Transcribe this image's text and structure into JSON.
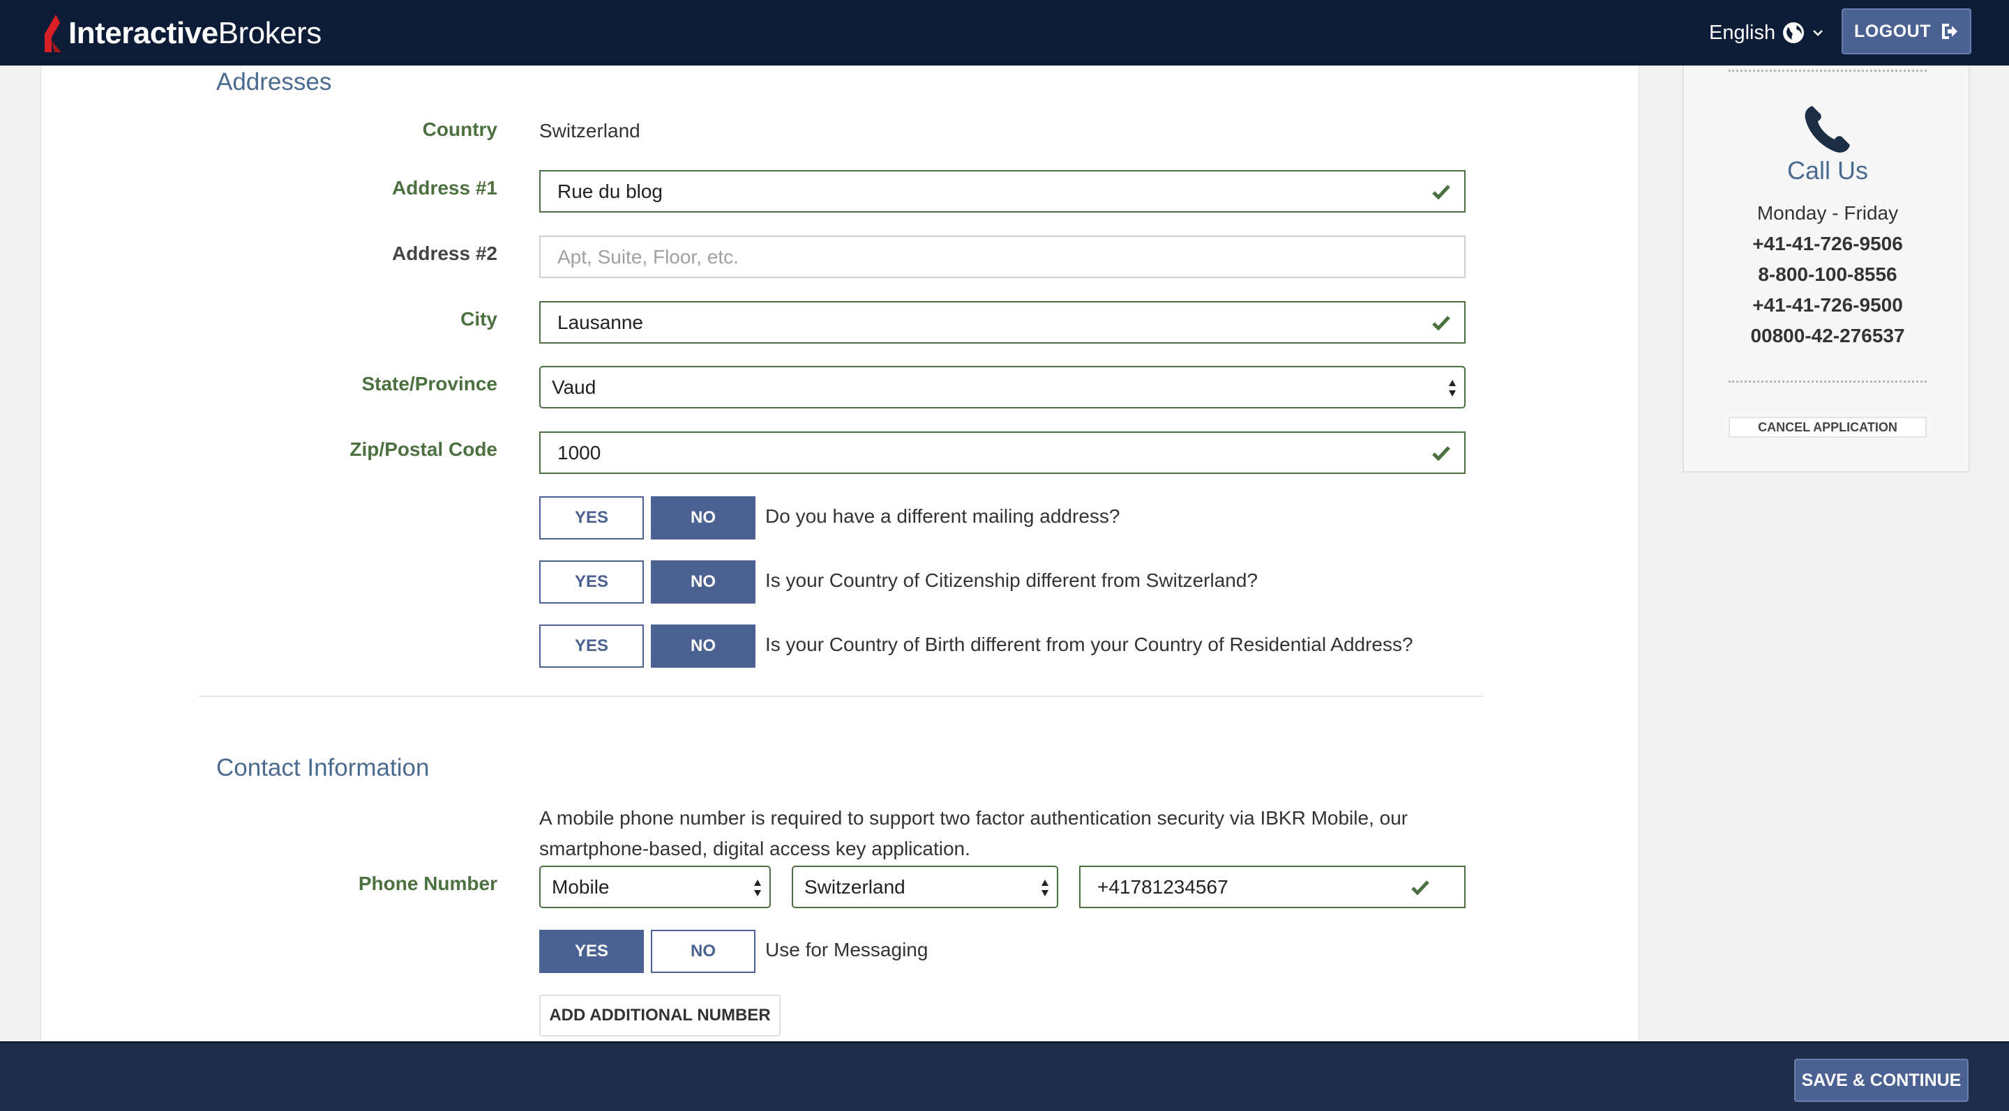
{
  "header": {
    "brand_bold": "Interactive",
    "brand_light": "Brokers",
    "language": "English",
    "logout_label": "LOGOUT"
  },
  "addresses": {
    "title": "Addresses",
    "country_label": "Country",
    "country_value": "Switzerland",
    "address1_label": "Address #1",
    "address1_value": "Rue du blog",
    "address2_label": "Address #2",
    "address2_placeholder": "Apt, Suite, Floor, etc.",
    "city_label": "City",
    "city_value": "Lausanne",
    "state_label": "State/Province",
    "state_value": "Vaud",
    "zip_label": "Zip/Postal Code",
    "zip_value": "1000",
    "questions": [
      {
        "yes": "YES",
        "no": "NO",
        "selected": "NO",
        "text": "Do you have a different mailing address?"
      },
      {
        "yes": "YES",
        "no": "NO",
        "selected": "NO",
        "text": "Is your Country of Citizenship different from Switzerland?"
      },
      {
        "yes": "YES",
        "no": "NO",
        "selected": "NO",
        "text": "Is your Country of Birth different from your Country of Residential Address?"
      }
    ]
  },
  "contact": {
    "title": "Contact Information",
    "info": "A mobile phone number is required to support two factor authentication security via IBKR Mobile, our smartphone-based, digital access key application.",
    "phone_label": "Phone Number",
    "phone_type": "Mobile",
    "phone_country": "Switzerland",
    "phone_number": "+41781234567",
    "messaging": {
      "yes": "YES",
      "no": "NO",
      "selected": "YES",
      "text": "Use for Messaging"
    },
    "add_number_label": "ADD ADDITIONAL NUMBER"
  },
  "sidebar": {
    "call_title": "Call Us",
    "hours": "Monday - Friday",
    "phones": [
      "+41-41-726-9506",
      "8-800-100-8556",
      "+41-41-726-9500",
      "00800-42-276537"
    ],
    "cancel_label": "CANCEL APPLICATION"
  },
  "footer": {
    "save_label": "SAVE & CONTINUE"
  },
  "colors": {
    "nav_bg": "#0d1c36",
    "accent": "#4a6192",
    "valid_green": "#4c7040",
    "section_title": "#4a6a8f",
    "footer_bg": "#1f2d4a"
  },
  "icons": [
    "logo-mark-icon",
    "globe-icon",
    "chevron-down-icon",
    "logout-icon",
    "check-icon",
    "select-arrows-icon",
    "phone-icon"
  ]
}
